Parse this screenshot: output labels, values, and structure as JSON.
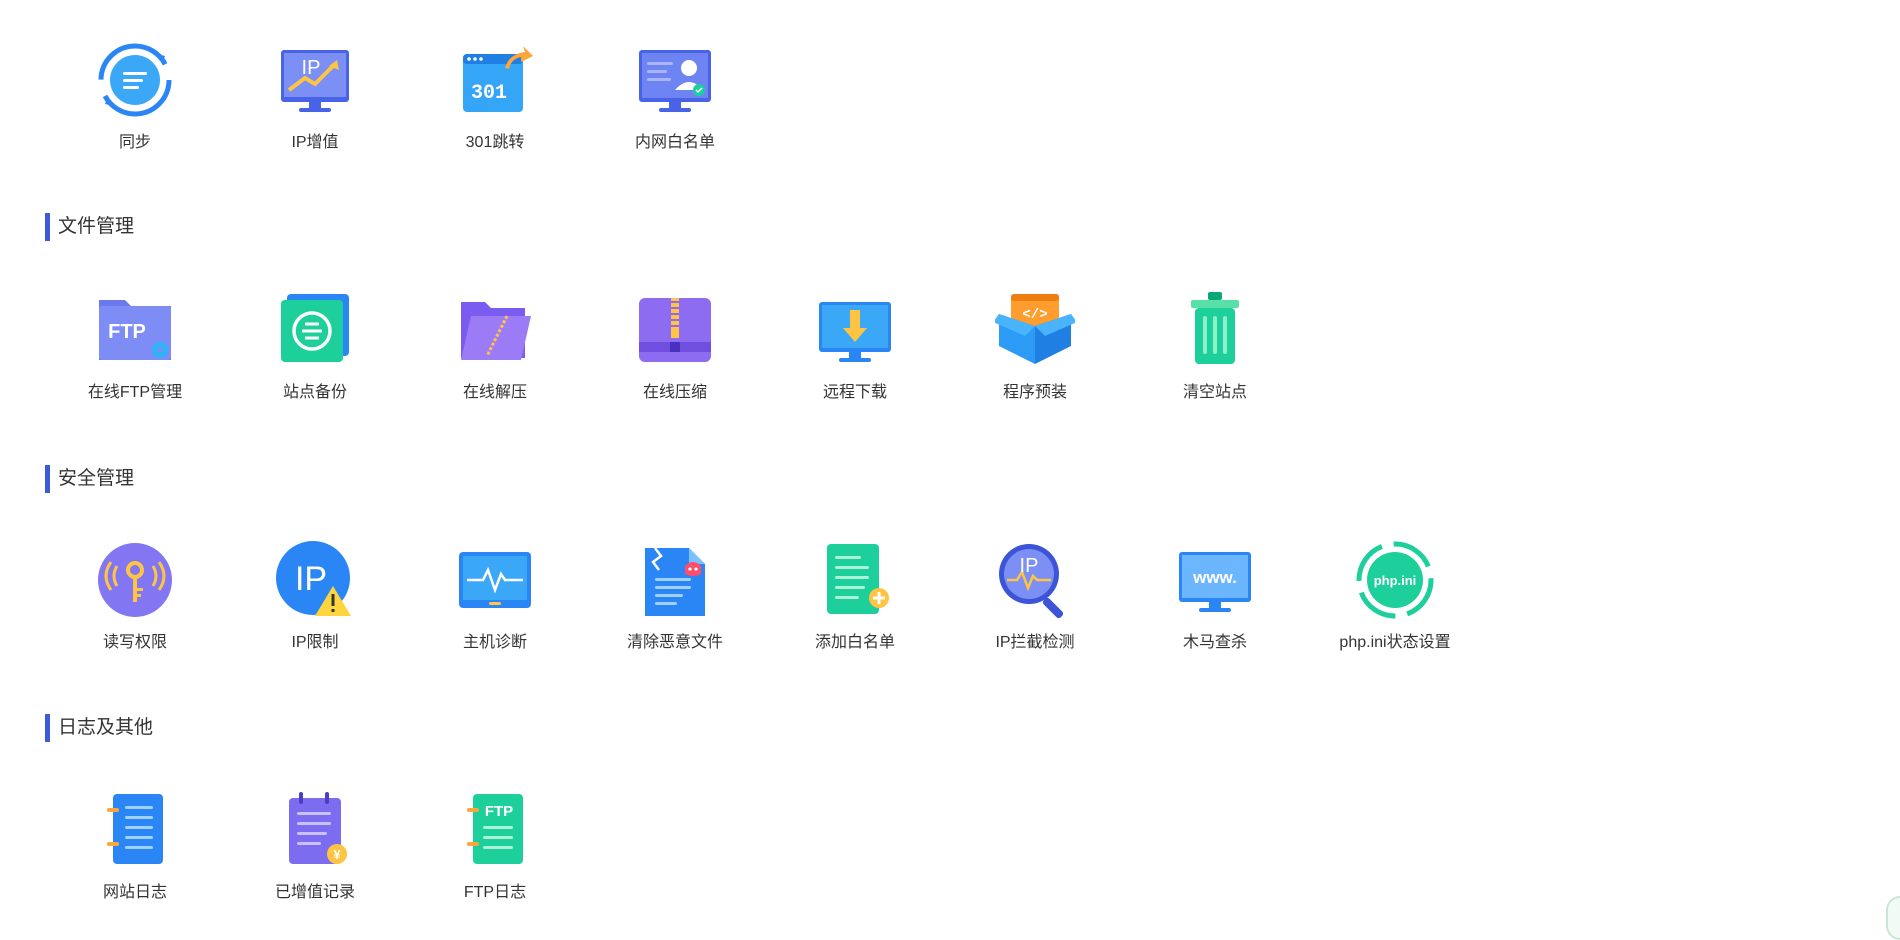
{
  "sections": [
    {
      "title": "",
      "items": [
        "同步",
        "IP增值",
        "301跳转",
        "内网白名单"
      ]
    },
    {
      "title": "文件管理",
      "items": [
        "在线FTP管理",
        "站点备份",
        "在线解压",
        "在线压缩",
        "远程下载",
        "程序预装",
        "清空站点"
      ]
    },
    {
      "title": "安全管理",
      "items": [
        "读写权限",
        "IP限制",
        "主机诊断",
        "清除恶意文件",
        "添加白名单",
        "IP拦截检测",
        "木马查杀",
        "php.ini状态设置"
      ]
    },
    {
      "title": "日志及其他",
      "items": [
        "网站日志",
        "已增值记录",
        "FTP日志"
      ]
    }
  ],
  "icon_text": {
    "ip": "IP",
    "redirect": "301",
    "ftp": "FTP",
    "code": "</>",
    "www": "www.",
    "phpini": "php.ini",
    "yen": "¥"
  },
  "icons": {
    "sync": "sync-icon",
    "ip_upgrade": "ip-upgrade-icon",
    "redirect": "redirect-301-icon",
    "intranet_whitelist": "intranet-whitelist-icon",
    "ftp_manage": "ftp-folder-icon",
    "backup": "site-backup-icon",
    "unzip": "unzip-folder-icon",
    "zip": "zip-archive-icon",
    "remote_download": "remote-download-icon",
    "preinstall": "program-box-icon",
    "clear_site": "trash-icon",
    "permission": "key-permission-icon",
    "ip_limit": "ip-warning-icon",
    "diagnose": "monitor-pulse-icon",
    "malware_clean": "malware-file-icon",
    "add_whitelist": "add-document-icon",
    "ip_block_check": "ip-magnifier-icon",
    "trojan_scan": "www-monitor-icon",
    "phpini": "phpini-settings-icon",
    "site_log": "notebook-log-icon",
    "upgrade_record": "notepad-yen-icon",
    "ftp_log": "ftp-notebook-icon"
  },
  "colors": {
    "accent_bar": "#3d5bd6",
    "blue": "#2b86f5",
    "purple": "#7b6cf0",
    "green": "#1dcf9b",
    "yellow": "#ffc542"
  }
}
